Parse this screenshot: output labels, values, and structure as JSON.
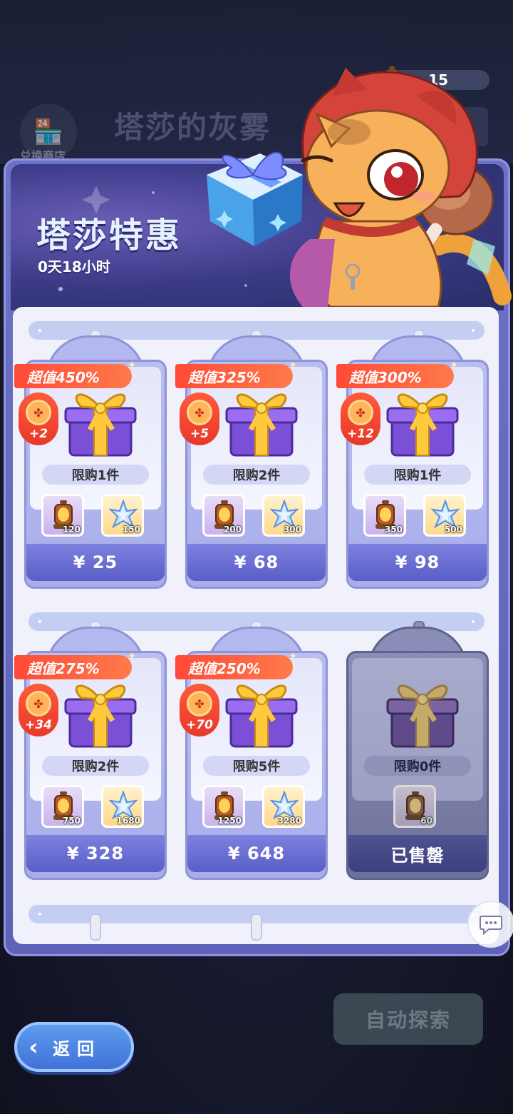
{
  "background": {
    "shop_label": "兑换商店",
    "title": "塔莎的灰雾"
  },
  "currency": {
    "icon": "lantern-icon",
    "value": "15"
  },
  "banner": {
    "title": "塔莎特惠",
    "timer": "0天18小时"
  },
  "offers": [
    {
      "ribbon": "超值450%",
      "bonus": "+2",
      "limit": "限购1件",
      "lantern_amount": "120",
      "star_amount": "150",
      "price": "¥ 25",
      "sold_out": false
    },
    {
      "ribbon": "超值325%",
      "bonus": "+5",
      "limit": "限购2件",
      "lantern_amount": "200",
      "star_amount": "300",
      "price": "¥ 68",
      "sold_out": false
    },
    {
      "ribbon": "超值300%",
      "bonus": "+12",
      "limit": "限购1件",
      "lantern_amount": "350",
      "star_amount": "500",
      "price": "¥ 98",
      "sold_out": false
    },
    {
      "ribbon": "超值275%",
      "bonus": "+34",
      "limit": "限购2件",
      "lantern_amount": "750",
      "star_amount": "1680",
      "price": "¥ 328",
      "sold_out": false
    },
    {
      "ribbon": "超值250%",
      "bonus": "+70",
      "limit": "限购5件",
      "lantern_amount": "1250",
      "star_amount": "3280",
      "price": "¥ 648",
      "sold_out": false
    },
    {
      "limit": "限购0件",
      "lantern_amount": "60",
      "price": "已售罄",
      "sold_out": true
    }
  ],
  "buttons": {
    "back": "返回",
    "auto_explore": "自动探索"
  },
  "colors": {
    "ribbon": "#ff4a38",
    "price_button": "#5a5fc7",
    "panel": "#6e72c6"
  }
}
